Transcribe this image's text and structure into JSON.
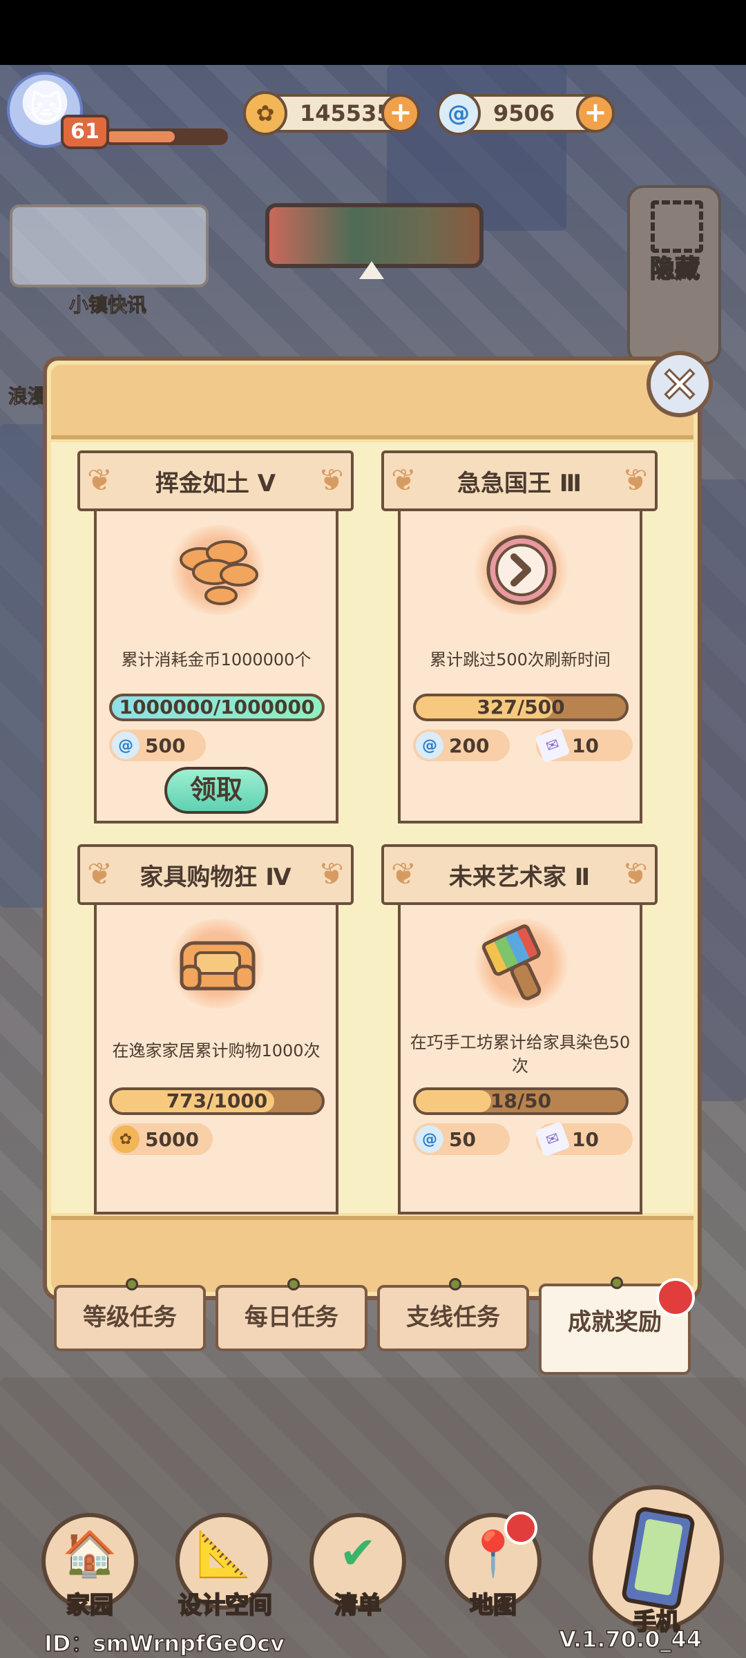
{
  "hud": {
    "level": "61",
    "coins": "145535",
    "gems": "9506",
    "hide_label": "隐藏",
    "news_label": "小镇快讯",
    "romance_label": "浪漫"
  },
  "achievements": [
    {
      "title": "挥金如土 Ⅴ",
      "icon": "coin-pile-icon",
      "desc": "累计消耗金币1000000个",
      "progress_text": "1000000/1000000",
      "progress": 1.0,
      "complete": true,
      "rewards": [
        {
          "type": "gem",
          "value": "500"
        }
      ],
      "claim_label": "领取"
    },
    {
      "title": "急急国王 Ⅲ",
      "icon": "clock-icon",
      "desc": "累计跳过500次刷新时间",
      "progress_text": "327/500",
      "progress": 0.654,
      "complete": false,
      "rewards": [
        {
          "type": "gem",
          "value": "200"
        },
        {
          "type": "ticket",
          "value": "10"
        }
      ]
    },
    {
      "title": "家具购物狂 Ⅳ",
      "icon": "sofa-icon",
      "desc": "在逸家家居累计购物1000次",
      "progress_text": "773/1000",
      "progress": 0.773,
      "complete": false,
      "rewards": [
        {
          "type": "coin",
          "value": "5000"
        }
      ]
    },
    {
      "title": "未来艺术家 Ⅱ",
      "icon": "paint-brush-icon",
      "desc": "在巧手工坊累计给家具染色50次",
      "progress_text": "18/50",
      "progress": 0.36,
      "complete": false,
      "rewards": [
        {
          "type": "gem",
          "value": "50"
        },
        {
          "type": "ticket",
          "value": "10"
        }
      ]
    }
  ],
  "tabs": [
    {
      "label": "等级任务",
      "active": false
    },
    {
      "label": "每日任务",
      "active": false
    },
    {
      "label": "支线任务",
      "active": false
    },
    {
      "label": "成就奖励",
      "active": true
    }
  ],
  "nav": [
    {
      "label": "家园",
      "icon": "house-icon"
    },
    {
      "label": "设计空间",
      "icon": "ruler-icon"
    },
    {
      "label": "清单",
      "icon": "checklist-icon"
    },
    {
      "label": "地图",
      "icon": "map-pin-icon"
    },
    {
      "label": "手机",
      "icon": "phone-icon"
    }
  ],
  "footer": {
    "id_text": "ID：smWrnpfGeOcv",
    "version": "V.1.70.0_44"
  },
  "colors": {
    "panel_bg": "#f7e1a6",
    "card_bg": "#fde6cf",
    "progress_fill": "#f7c97f",
    "progress_done": "#8ef0c0",
    "notification_dot": "#e23d3d"
  }
}
